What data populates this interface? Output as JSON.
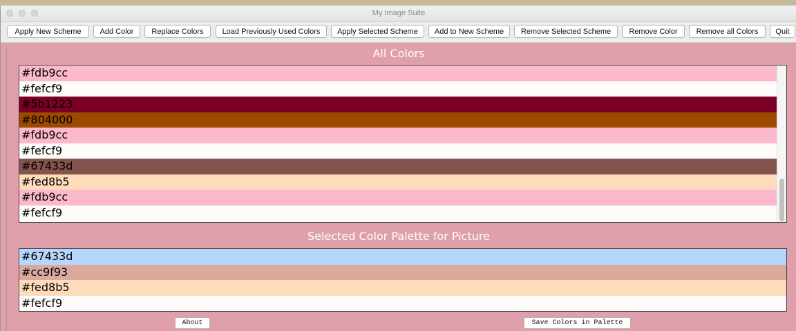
{
  "window": {
    "title": "My Image Suite"
  },
  "toolbar": {
    "buttons": [
      "Apply New Scheme",
      "Add Color",
      "Replace Colors",
      "Load Previously Used Colors",
      "Apply Selected Scheme",
      "Add to New Scheme",
      "Remove Selected Scheme",
      "Remove Color",
      "Remove all Colors",
      "Quit"
    ]
  },
  "all_colors": {
    "heading": "All Colors",
    "items": [
      {
        "label": "#fdb9cc",
        "bg": "#fdb9cc"
      },
      {
        "label": "#fefcf9",
        "bg": "#fefcf9"
      },
      {
        "label": "#5b1223",
        "bg": "#7a0026"
      },
      {
        "label": "#804000",
        "bg": "#9c4a00"
      },
      {
        "label": "#fdb9cc",
        "bg": "#fdb9cc"
      },
      {
        "label": "#fefcf9",
        "bg": "#fefcf9"
      },
      {
        "label": "#67433d",
        "bg": "#84534c"
      },
      {
        "label": "#fed8b5",
        "bg": "#fedcbb"
      },
      {
        "label": "#fdb9cc",
        "bg": "#fdb9cc"
      },
      {
        "label": "#fefcf9",
        "bg": "#fefcf9"
      }
    ]
  },
  "palette": {
    "heading": "Selected Color Palette for Picture",
    "items": [
      {
        "label": "#67433d",
        "bg": "#b6d7fb",
        "selected": true
      },
      {
        "label": "#cc9f93",
        "bg": "#dca99e"
      },
      {
        "label": "#fed8b5",
        "bg": "#fedcbb"
      },
      {
        "label": "#fefcf9",
        "bg": "#fefcf9"
      }
    ]
  },
  "footer": {
    "about_label": "About",
    "save_label": "Save Colors in Palette"
  }
}
